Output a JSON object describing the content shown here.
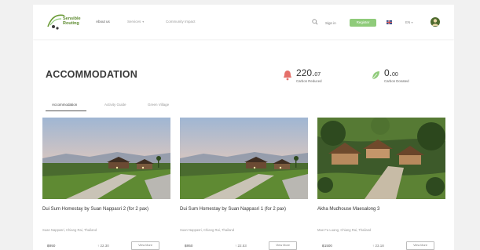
{
  "header": {
    "logo_text_line1": "Sensible",
    "logo_text_line2": "Routing",
    "nav": [
      {
        "label": "About us",
        "active": true
      },
      {
        "label": "Services",
        "has_dropdown": true
      },
      {
        "label": "Community Impact"
      }
    ],
    "sign_in_label": "Sign in",
    "register_label": "Register",
    "language_label": "EN",
    "icons": [
      "search-icon",
      "flag-icon",
      "chevron-down-icon",
      "user-avatar"
    ],
    "accent_color": "#8fcb7a"
  },
  "main": {
    "title": "ACCOMMODATION",
    "stats": [
      {
        "value_main": "220.",
        "value_small": "07",
        "label": "Carbon Reduced",
        "icon": "bell-icon",
        "color": "#e5706a"
      },
      {
        "value_main": "0.",
        "value_small": "00",
        "label": "Carbon Donated",
        "icon": "leaf-icon",
        "color": "#8fcb7a"
      }
    ],
    "tabs": [
      {
        "label": "Accommodation",
        "active": true
      },
      {
        "label": "Activity Guide"
      },
      {
        "label": "Green Village"
      }
    ],
    "cards": [
      {
        "title": "Dui Sum Homestay by Suan Nappasri 2 (for 2 pax)",
        "location": "Suan Nappasri, Chiang Rai, Thailand",
        "price": "฿950",
        "carbon": "↑ 22.30",
        "button": "View More",
        "image": "resort-dusk"
      },
      {
        "title": "Dui Sum Homestay by Suan Nappasri 1 (for 2 pax)",
        "location": "Suan Nappasri, Chiang Rai, Thailand",
        "price": "฿950",
        "carbon": "↑ 22.53",
        "button": "View More",
        "image": "resort-dusk"
      },
      {
        "title": "Akha Mudhouse Maesalong 3",
        "location": "Mae Fa Luang, Chiang Rai, Thailand",
        "price": "฿1500",
        "carbon": "↑ 23.18",
        "button": "View More",
        "image": "mudhouse-hillside"
      }
    ]
  }
}
